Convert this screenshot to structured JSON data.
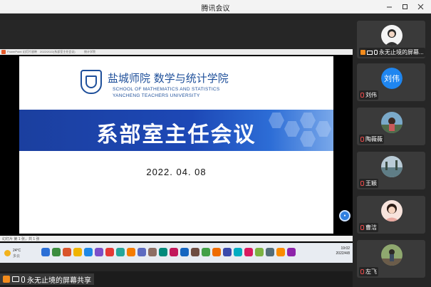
{
  "window": {
    "title": "腾讯会议"
  },
  "shared_screen": {
    "app_tabs": [
      "PowerPoint",
      "幻灯片放映",
      "2022/2022(系部室主任会议)",
      "统计学院"
    ],
    "slide": {
      "school_name_cn": "盐城师院 数学与统计学院",
      "school_name_en_1": "SCHOOL OF MATHEMATICS AND STATISTICS",
      "school_name_en_2": "YANCHENG TEACHERS UNIVERSITY",
      "banner_title": "系部室主任会议",
      "date": "2022. 04. 08"
    },
    "status_text": "幻灯片 第 1 张，共 1 张",
    "weather": {
      "temp": "24°C",
      "cond": "多云"
    },
    "clock": {
      "time": "19:02",
      "date": "2022/4/8"
    },
    "taskbar_app_colors": [
      "#2b6fd6",
      "#3c8d3f",
      "#d9552b",
      "#f0b400",
      "#1e88e5",
      "#7b4fc9",
      "#e53935",
      "#26a69a",
      "#f57c00",
      "#5c6bc0",
      "#8d6e63",
      "#00897b",
      "#c2185b",
      "#1565c0",
      "#6d4c41",
      "#43a047",
      "#ef6c00",
      "#3949ab",
      "#00acc1",
      "#d81b60",
      "#7cb342",
      "#546e7a",
      "#fb8c00",
      "#8e24aa",
      "#0097a7",
      "#e57373",
      "#4db6ac",
      "#ffb300",
      "#5e35b1",
      "#9ccc65"
    ]
  },
  "share_label": "永无止境的屏幕共享",
  "participants": [
    {
      "name": "永无止境的屏幕...",
      "avatar": "photo-girl-icon",
      "host": true,
      "sharing": true
    },
    {
      "name": "刘伟",
      "avatar_text": "刘伟"
    },
    {
      "name": "陶薇薇",
      "avatar": "photo-portrait-icon"
    },
    {
      "name": "王颖",
      "avatar": "photo-landscape-icon"
    },
    {
      "name": "曹洁",
      "avatar": "photo-girl-icon"
    },
    {
      "name": "左飞",
      "avatar": "photo-outdoor-icon"
    }
  ],
  "colors": {
    "accent": "#1f86f0",
    "banner": "#1d48b6",
    "host_badge": "#f28b1c"
  }
}
